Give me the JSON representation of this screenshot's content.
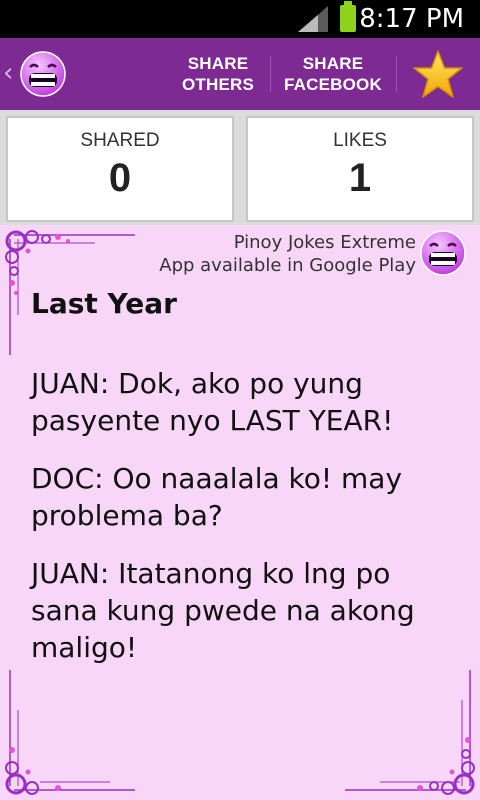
{
  "status_bar": {
    "time": "8:17 PM"
  },
  "toolbar": {
    "share_others": [
      "SHARE",
      "OTHERS"
    ],
    "share_facebook": [
      "SHARE",
      "FACEBOOK"
    ],
    "icons": [
      "back-chevron-icon",
      "laughing-face-icon",
      "star-icon"
    ]
  },
  "stats": {
    "shared_label": "SHARED",
    "shared_value": "0",
    "likes_label": "LIKES",
    "likes_value": "1"
  },
  "promo": {
    "line1": "Pinoy Jokes Extreme",
    "line2": "App available in Google Play"
  },
  "joke": {
    "title": "Last Year",
    "paragraphs": [
      "JUAN: Dok, ako po yung pasyente nyo LAST YEAR!",
      "DOC: Oo naaalala ko! may problema ba?",
      "JUAN: Itatanong ko lng po sana kung pwede na akong maligo!"
    ]
  },
  "colors": {
    "action_bar": "#7d2a93",
    "content_bg": "#f8d6f8",
    "star": "#f5c518",
    "ornament": "#9b2fc4"
  }
}
